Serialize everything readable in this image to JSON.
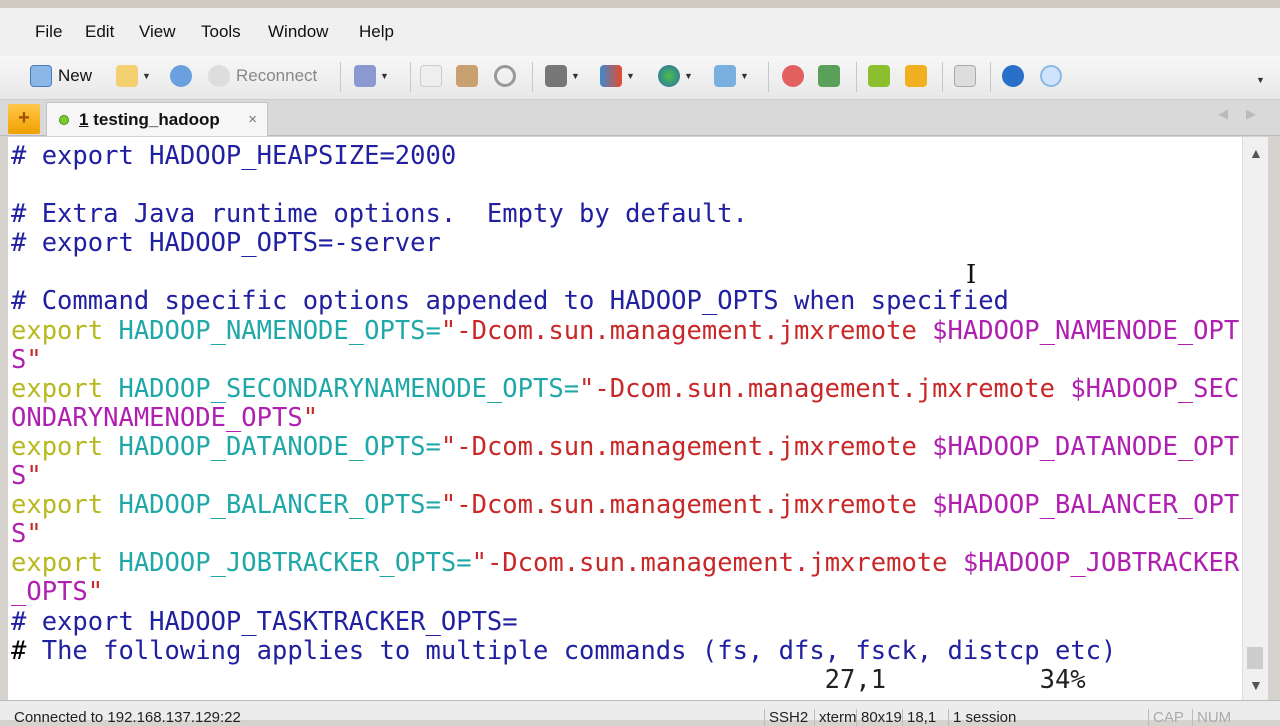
{
  "menu": [
    "File",
    "Edit",
    "View",
    "Tools",
    "Window",
    "Help"
  ],
  "toolbar": {
    "new_label": "New",
    "reconnect_label": "Reconnect"
  },
  "tab": {
    "number": "1",
    "title": "testing_hadoop",
    "close": "×"
  },
  "terminal": {
    "lines": [
      [
        [
          "# export HADOOP_HEAPSIZE=2000",
          "comment"
        ]
      ],
      [],
      [
        [
          "# Extra Java runtime options.  Empty by default.",
          "comment"
        ]
      ],
      [
        [
          "# export HADOOP_OPTS=-server",
          "comment"
        ]
      ],
      [],
      [
        [
          "# Command specific options appended to HADOOP_OPTS when specified",
          "comment"
        ]
      ],
      [
        [
          "export",
          "kw"
        ],
        [
          " HADOOP_NAMENODE_OPTS=",
          "var"
        ],
        [
          "\"-Dcom.sun.management.jmxremote ",
          "str"
        ],
        [
          "$HADOOP_NAMENODE_OPT",
          "ref"
        ]
      ],
      [
        [
          "S",
          "ref"
        ],
        [
          "\"",
          "str"
        ]
      ],
      [
        [
          "export",
          "kw"
        ],
        [
          " HADOOP_SECONDARYNAMENODE_OPTS=",
          "var"
        ],
        [
          "\"-Dcom.sun.management.jmxremote ",
          "str"
        ],
        [
          "$HADOOP_SEC",
          "ref"
        ]
      ],
      [
        [
          "ONDARYNAMENODE_OPTS",
          "ref"
        ],
        [
          "\"",
          "str"
        ]
      ],
      [
        [
          "export",
          "kw"
        ],
        [
          " HADOOP_DATANODE_OPTS=",
          "var"
        ],
        [
          "\"-Dcom.sun.management.jmxremote ",
          "str"
        ],
        [
          "$HADOOP_DATANODE_OPT",
          "ref"
        ]
      ],
      [
        [
          "S",
          "ref"
        ],
        [
          "\"",
          "str"
        ]
      ],
      [
        [
          "export",
          "kw"
        ],
        [
          " HADOOP_BALANCER_OPTS=",
          "var"
        ],
        [
          "\"-Dcom.sun.management.jmxremote ",
          "str"
        ],
        [
          "$HADOOP_BALANCER_OPT",
          "ref"
        ]
      ],
      [
        [
          "S",
          "ref"
        ],
        [
          "\"",
          "str"
        ]
      ],
      [
        [
          "export",
          "kw"
        ],
        [
          " HADOOP_JOBTRACKER_OPTS=",
          "var"
        ],
        [
          "\"-Dcom.sun.management.jmxremote ",
          "str"
        ],
        [
          "$HADOOP_JOBTRACKER",
          "ref"
        ]
      ],
      [
        [
          "_OPTS",
          "ref"
        ],
        [
          "\"",
          "str"
        ]
      ],
      [
        [
          "# export HADOOP_TASKTRACKER_OPTS=",
          "comment"
        ]
      ],
      [
        [
          "#",
          "cursor"
        ],
        [
          " The following applies to multiple commands (fs, dfs, fsck, distcp etc)",
          "comment"
        ]
      ],
      [
        [
          "                                                     27,1          34%",
          "plain"
        ]
      ]
    ]
  },
  "status": {
    "connection": "Connected to 192.168.137.129:22",
    "protocol": "SSH2",
    "terminal_type": "xterm",
    "size": "80x19",
    "position": "18,1",
    "sessions": "1 session",
    "cap": "CAP",
    "num": "NUM"
  }
}
